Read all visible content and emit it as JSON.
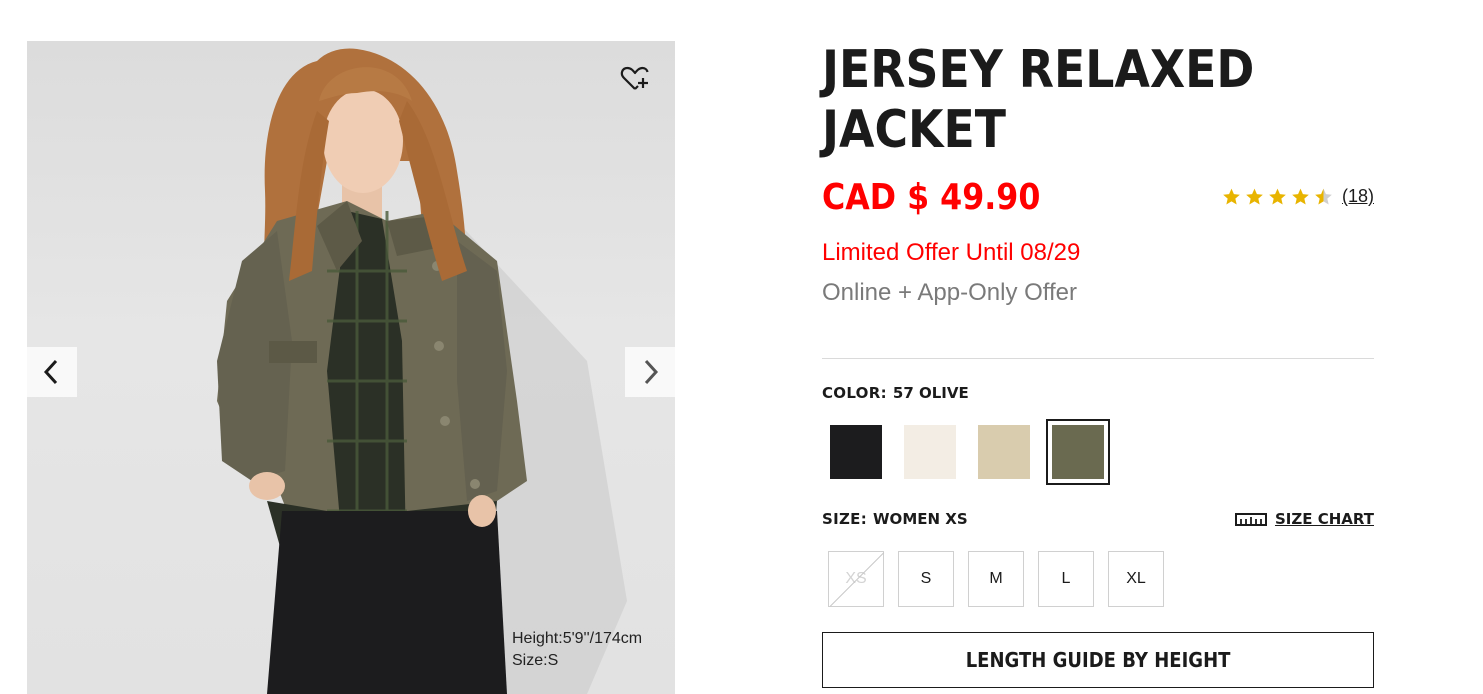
{
  "product": {
    "title": "JERSEY RELAXED JACKET",
    "price": "CAD $ 49.90",
    "offer": "Limited Offer Until 08/29",
    "offer_sub": "Online + App-Only Offer",
    "rating": {
      "value": 4.5,
      "max": 5,
      "reviews": "(18)"
    }
  },
  "gallery": {
    "model_height": "Height:5'9''/174cm",
    "model_size": "Size:S",
    "icons": {
      "wishlist": "heart-plus-icon",
      "prev": "chevron-left-icon",
      "next": "chevron-right-icon"
    }
  },
  "color": {
    "label": "COLOR:",
    "value": "57 OLIVE",
    "swatches": [
      {
        "name": "black",
        "color": "#1c1c1e",
        "selected": false
      },
      {
        "name": "off-white",
        "color": "#f3ede4",
        "selected": false
      },
      {
        "name": "beige",
        "color": "#d9ccae",
        "selected": false
      },
      {
        "name": "olive",
        "color": "#6a6a50",
        "selected": true
      }
    ]
  },
  "size": {
    "label": "SIZE:",
    "value": "WOMEN XS",
    "chart_label": "SIZE CHART",
    "options": [
      {
        "label": "XS",
        "available": false
      },
      {
        "label": "S",
        "available": true
      },
      {
        "label": "M",
        "available": true
      },
      {
        "label": "L",
        "available": true
      },
      {
        "label": "XL",
        "available": true
      }
    ]
  },
  "length_guide_label": "LENGTH GUIDE BY HEIGHT",
  "colors": {
    "price_red": "#ff0000",
    "star_gold": "#e8b400",
    "text": "#1b1b1b"
  }
}
